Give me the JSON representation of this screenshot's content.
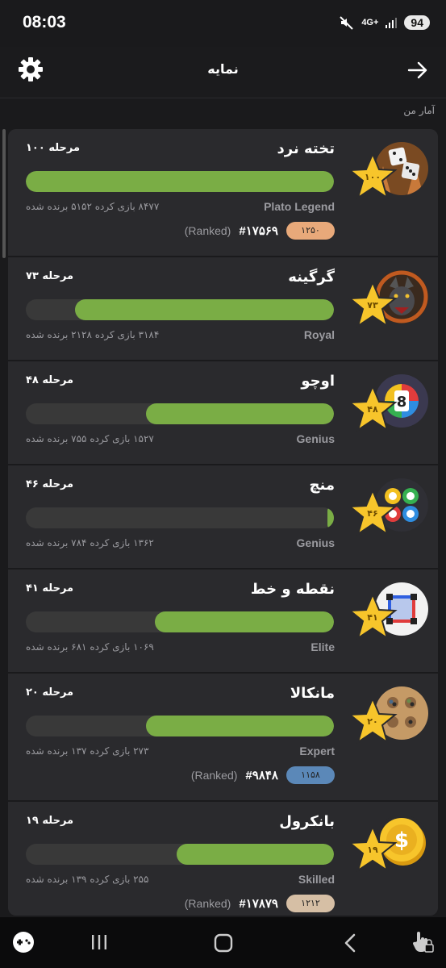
{
  "status": {
    "time": "08:03",
    "network": "4G+",
    "battery": "94"
  },
  "header": {
    "title": "نمایه"
  },
  "section": {
    "label": "آمار من"
  },
  "games": [
    {
      "title": "تخته نرد",
      "level": "مرحله ۱۰۰",
      "star": "۱۰۰",
      "tier": "Plato Legend",
      "stats": "۸۴۷۷ بازی کرده   ۵۱۵۲ برنده شده",
      "progress": 1.0,
      "rank": {
        "badge": "۱۲۵۰",
        "number": "#۱۷۵۶۹",
        "label": "(Ranked)",
        "color": "#e8a97a"
      }
    },
    {
      "title": "گرگینه",
      "level": "مرحله ۷۳",
      "star": "۷۳",
      "tier": "Royal",
      "stats": "۳۱۸۴ بازی کرده   ۲۱۲۸ برنده شده",
      "progress": 0.84
    },
    {
      "title": "اوچو",
      "level": "مرحله ۴۸",
      "star": "۴۸",
      "tier": "Genius",
      "stats": "۱۵۲۷ بازی کرده   ۷۵۵ برنده شده",
      "progress": 0.61
    },
    {
      "title": "منچ",
      "level": "مرحله ۴۶",
      "star": "۴۶",
      "tier": "Genius",
      "stats": "۱۳۶۲ بازی کرده   ۷۸۴ برنده شده",
      "progress": 0.02
    },
    {
      "title": "نقطه و خط",
      "level": "مرحله ۴۱",
      "star": "۴۱",
      "tier": "Elite",
      "stats": "۱۰۶۹ بازی کرده   ۶۸۱ برنده شده",
      "progress": 0.58
    },
    {
      "title": "مانکالا",
      "level": "مرحله ۲۰",
      "star": "۲۰",
      "tier": "Expert",
      "stats": "۲۷۳ بازی کرده   ۱۳۷ برنده شده",
      "progress": 0.61,
      "rank": {
        "badge": "۱۱۵۸",
        "number": "#۹۸۴۸",
        "label": "(Ranked)",
        "color": "#5b88b8"
      }
    },
    {
      "title": "بانکرول",
      "level": "مرحله ۱۹",
      "star": "۱۹",
      "tier": "Skilled",
      "stats": "۲۵۵ بازی کرده   ۱۳۹ برنده شده",
      "progress": 0.51,
      "rank": {
        "badge": "۱۲۱۲",
        "number": "#۱۷۸۷۹",
        "label": "(Ranked)",
        "color": "#d6bfa5"
      }
    }
  ],
  "icons": [
    "backgammon-icon",
    "werewolf-icon",
    "uno-icon",
    "ludo-icon",
    "dots-boxes-icon",
    "mancala-icon",
    "coin-icon"
  ]
}
